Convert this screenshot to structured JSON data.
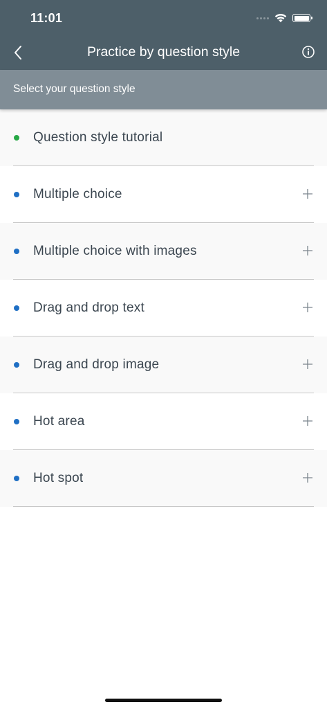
{
  "status_bar": {
    "time": "11:01"
  },
  "header": {
    "title": "Practice by question style",
    "back_icon": "chevron-left-icon",
    "info_icon": "info-icon"
  },
  "subheader": {
    "text": "Select your question style"
  },
  "colors": {
    "header_bg": "#4d5f69",
    "subheader_bg": "#808d96",
    "green_dot": "#27a845",
    "blue_dot": "#1f6fc4",
    "text": "#3b4650"
  },
  "items": [
    {
      "label": "Question style tutorial",
      "dot_color": "#27a845",
      "expandable": false
    },
    {
      "label": "Multiple choice",
      "dot_color": "#1f6fc4",
      "expandable": true
    },
    {
      "label": "Multiple choice with images",
      "dot_color": "#1f6fc4",
      "expandable": true
    },
    {
      "label": "Drag and drop text",
      "dot_color": "#1f6fc4",
      "expandable": true
    },
    {
      "label": "Drag and drop image",
      "dot_color": "#1f6fc4",
      "expandable": true
    },
    {
      "label": "Hot area",
      "dot_color": "#1f6fc4",
      "expandable": true
    },
    {
      "label": "Hot spot",
      "dot_color": "#1f6fc4",
      "expandable": true
    }
  ]
}
